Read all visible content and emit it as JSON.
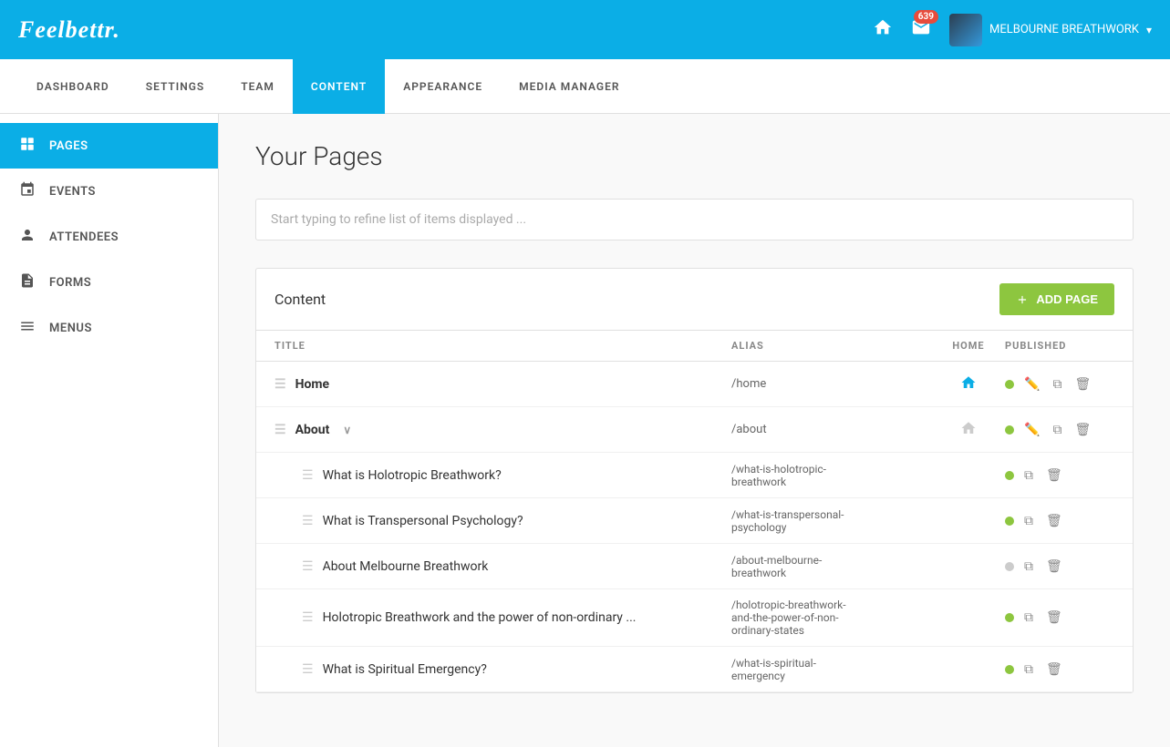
{
  "header": {
    "logo": "Feelbettr.",
    "notification_count": "639",
    "user_name": "MELBOURNE BREATHWORK"
  },
  "nav": {
    "items": [
      {
        "label": "DASHBOARD",
        "active": false
      },
      {
        "label": "SETTINGS",
        "active": false
      },
      {
        "label": "TEAM",
        "active": false
      },
      {
        "label": "CONTENT",
        "active": true
      },
      {
        "label": "APPEARANCE",
        "active": false
      },
      {
        "label": "MEDIA MANAGER",
        "active": false
      }
    ]
  },
  "sidebar": {
    "items": [
      {
        "label": "PAGES",
        "icon": "pages",
        "active": true
      },
      {
        "label": "EVENTS",
        "icon": "events",
        "active": false
      },
      {
        "label": "ATTENDEES",
        "icon": "attendees",
        "active": false
      },
      {
        "label": "FORMS",
        "icon": "forms",
        "active": false
      },
      {
        "label": "MENUS",
        "icon": "menus",
        "active": false
      }
    ]
  },
  "main": {
    "page_title": "Your Pages",
    "search_placeholder": "Start typing to refine list of items displayed ...",
    "content_section_title": "Content",
    "add_page_label": "ADD PAGE",
    "table": {
      "columns": [
        "TITLE",
        "ALIAS",
        "HOME",
        "PUBLISHED"
      ],
      "rows": [
        {
          "title": "Home",
          "bold": true,
          "alias": "/home",
          "home": true,
          "published": true,
          "level": 0,
          "expandable": false
        },
        {
          "title": "About",
          "bold": true,
          "alias": "/about",
          "home": false,
          "published": true,
          "level": 0,
          "expandable": true
        },
        {
          "title": "What is Holotropic Breathwork?",
          "bold": false,
          "alias": "/what-is-holotropic-breathwork",
          "home": false,
          "published": true,
          "level": 1,
          "expandable": false
        },
        {
          "title": "What is Transpersonal Psychology?",
          "bold": false,
          "alias": "/what-is-transpersonal-psychology",
          "home": false,
          "published": true,
          "level": 1,
          "expandable": false
        },
        {
          "title": "About Melbourne Breathwork",
          "bold": false,
          "alias": "/about-melbourne-breathwork",
          "home": false,
          "published": false,
          "level": 1,
          "expandable": false
        },
        {
          "title": "Holotropic Breathwork and the power of non-ordinary ...",
          "bold": false,
          "alias": "/holotropic-breathwork-and-the-power-of-non-ordinary-states",
          "home": false,
          "published": true,
          "level": 1,
          "expandable": false
        },
        {
          "title": "What is Spiritual Emergency?",
          "bold": false,
          "alias": "/what-is-spiritual-emergency",
          "home": false,
          "published": true,
          "level": 1,
          "expandable": false
        }
      ]
    }
  },
  "colors": {
    "primary": "#0baee6",
    "green": "#8dc63f",
    "red": "#e74c3c"
  }
}
